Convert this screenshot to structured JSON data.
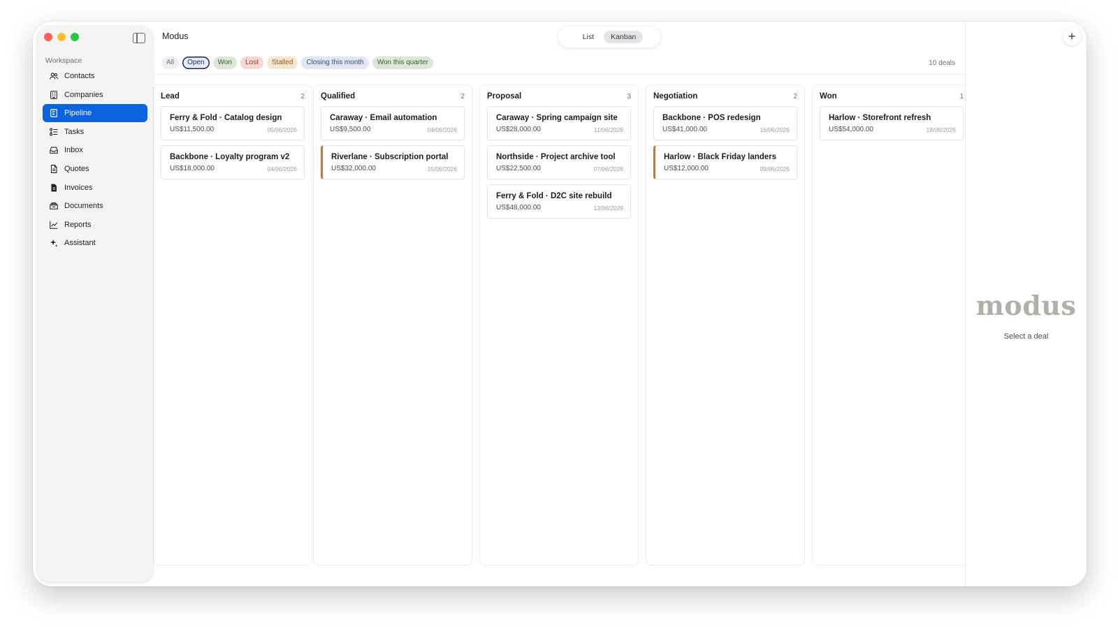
{
  "app": {
    "title": "Modus"
  },
  "view_toggle": {
    "options": [
      "List",
      "Kanban"
    ],
    "selected": "Kanban"
  },
  "sidebar": {
    "section_label": "Workspace",
    "items": [
      {
        "label": "Contacts",
        "icon": "contacts-icon",
        "active": false
      },
      {
        "label": "Companies",
        "icon": "building-icon",
        "active": false
      },
      {
        "label": "Pipeline",
        "icon": "pipeline-icon",
        "active": true
      },
      {
        "label": "Tasks",
        "icon": "tasks-icon",
        "active": false
      },
      {
        "label": "Inbox",
        "icon": "inbox-icon",
        "active": false
      },
      {
        "label": "Quotes",
        "icon": "quote-document-icon",
        "active": false
      },
      {
        "label": "Invoices",
        "icon": "invoice-document-icon",
        "active": false
      },
      {
        "label": "Documents",
        "icon": "documents-icon",
        "active": false
      },
      {
        "label": "Reports",
        "icon": "chart-line-icon",
        "active": false
      },
      {
        "label": "Assistant",
        "icon": "sparkle-icon",
        "active": false
      }
    ]
  },
  "filters": {
    "chips": [
      {
        "label": "All",
        "style": "all"
      },
      {
        "label": "Open",
        "style": "open",
        "selected": true
      },
      {
        "label": "Won",
        "style": "won"
      },
      {
        "label": "Lost",
        "style": "lost"
      },
      {
        "label": "Stalled",
        "style": "stalled"
      },
      {
        "label": "Closing this month",
        "style": "closing"
      },
      {
        "label": "Won this quarter",
        "style": "wonq"
      }
    ],
    "deal_count": "10 deals"
  },
  "columns": [
    {
      "title": "Lead",
      "count": "2",
      "cards": [
        {
          "title": "Ferry & Fold · Catalog design",
          "amount": "US$11,500.00",
          "date": "05/06/2026",
          "flag": false
        },
        {
          "title": "Backbone · Loyalty program v2",
          "amount": "US$18,000.00",
          "date": "04/06/2026",
          "flag": false
        }
      ]
    },
    {
      "title": "Qualified",
      "count": "2",
      "cards": [
        {
          "title": "Caraway · Email automation",
          "amount": "US$9,500.00",
          "date": "04/06/2026",
          "flag": false
        },
        {
          "title": "Riverlane · Subscription portal",
          "amount": "US$32,000.00",
          "date": "15/06/2026",
          "flag": true
        }
      ]
    },
    {
      "title": "Proposal",
      "count": "3",
      "cards": [
        {
          "title": "Caraway · Spring campaign site",
          "amount": "US$28,000.00",
          "date": "11/06/2026",
          "flag": false
        },
        {
          "title": "Northside · Project archive tool",
          "amount": "US$22,500.00",
          "date": "07/06/2026",
          "flag": false
        },
        {
          "title": "Ferry & Fold · D2C site rebuild",
          "amount": "US$48,000.00",
          "date": "13/06/2026",
          "flag": false
        }
      ]
    },
    {
      "title": "Negotiation",
      "count": "2",
      "cards": [
        {
          "title": "Backbone · POS redesign",
          "amount": "US$41,000.00",
          "date": "16/06/2026",
          "flag": false
        },
        {
          "title": "Harlow · Black Friday landers",
          "amount": "US$12,000.00",
          "date": "09/06/2026",
          "flag": true
        }
      ]
    },
    {
      "title": "Won",
      "count": "1",
      "cards": [
        {
          "title": "Harlow · Storefront refresh",
          "amount": "US$54,000.00",
          "date": "18/06/2026",
          "flag": false
        }
      ]
    }
  ],
  "detail": {
    "logo": "modus",
    "empty_message": "Select a deal",
    "add_icon": "plus-icon"
  },
  "colors": {
    "accent": "#0b63e0",
    "flag": "#c4773a",
    "logo": "#b2b0a6"
  }
}
